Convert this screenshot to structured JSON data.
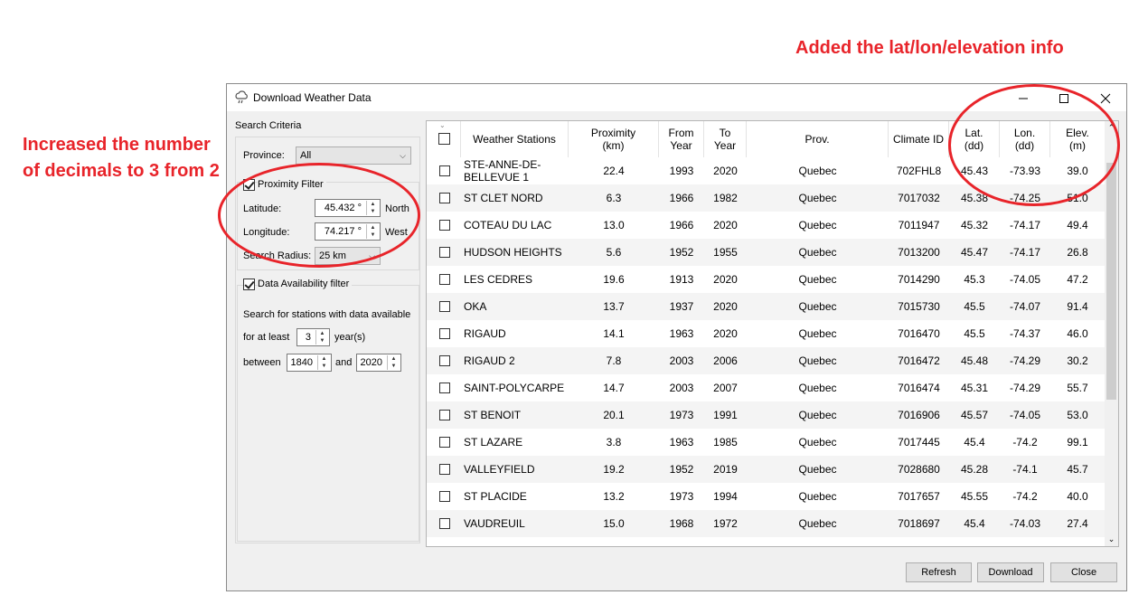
{
  "annotations": {
    "left": "Increased the number of decimals to 3 from 2",
    "top": "Added the lat/lon/elevation info"
  },
  "window": {
    "title": "Download Weather Data",
    "icon": "cloud-rain-icon",
    "minimize": "—",
    "maximize": "☐",
    "close": "✕"
  },
  "criteria": {
    "title": "Search Criteria",
    "province_label": "Province:",
    "province_value": "All",
    "proximity_filter_label": "Proximity Filter",
    "proximity_checked": true,
    "latitude_label": "Latitude:",
    "latitude_value": "45.432 °",
    "latitude_dir": "North",
    "longitude_label": "Longitude:",
    "longitude_value": "74.217 °",
    "longitude_dir": "West",
    "radius_label": "Search Radius:",
    "radius_value": "25 km",
    "availability_label": "Data Availability filter",
    "availability_checked": true,
    "availability_text": "Search for stations with data available",
    "at_least_label": "for at least",
    "at_least_value": "3",
    "years_label": "year(s)",
    "between_label": "between",
    "between_from": "1840",
    "and_label": "and",
    "between_to": "2020"
  },
  "table": {
    "headers": {
      "name": "Weather Stations",
      "proximity": "Proximity\n(km)",
      "from": "From\nYear",
      "to": "To\nYear",
      "prov": "Prov.",
      "climate_id": "Climate ID",
      "lat": "Lat.\n(dd)",
      "lon": "Lon.\n(dd)",
      "elev": "Elev.\n(m)"
    },
    "rows": [
      {
        "name": "STE-ANNE-DE-BELLEVUE 1",
        "proximity": "22.4",
        "from": "1993",
        "to": "2020",
        "prov": "Quebec",
        "climate_id": "702FHL8",
        "lat": "45.43",
        "lon": "-73.93",
        "elev": "39.0"
      },
      {
        "name": "ST CLET NORD",
        "proximity": "6.3",
        "from": "1966",
        "to": "1982",
        "prov": "Quebec",
        "climate_id": "7017032",
        "lat": "45.38",
        "lon": "-74.25",
        "elev": "51.0"
      },
      {
        "name": "COTEAU DU LAC",
        "proximity": "13.0",
        "from": "1966",
        "to": "2020",
        "prov": "Quebec",
        "climate_id": "7011947",
        "lat": "45.32",
        "lon": "-74.17",
        "elev": "49.4"
      },
      {
        "name": "HUDSON HEIGHTS",
        "proximity": "5.6",
        "from": "1952",
        "to": "1955",
        "prov": "Quebec",
        "climate_id": "7013200",
        "lat": "45.47",
        "lon": "-74.17",
        "elev": "26.8"
      },
      {
        "name": "LES CEDRES",
        "proximity": "19.6",
        "from": "1913",
        "to": "2020",
        "prov": "Quebec",
        "climate_id": "7014290",
        "lat": "45.3",
        "lon": "-74.05",
        "elev": "47.2"
      },
      {
        "name": "OKA",
        "proximity": "13.7",
        "from": "1937",
        "to": "2020",
        "prov": "Quebec",
        "climate_id": "7015730",
        "lat": "45.5",
        "lon": "-74.07",
        "elev": "91.4"
      },
      {
        "name": "RIGAUD",
        "proximity": "14.1",
        "from": "1963",
        "to": "2020",
        "prov": "Quebec",
        "climate_id": "7016470",
        "lat": "45.5",
        "lon": "-74.37",
        "elev": "46.0"
      },
      {
        "name": "RIGAUD 2",
        "proximity": "7.8",
        "from": "2003",
        "to": "2006",
        "prov": "Quebec",
        "climate_id": "7016472",
        "lat": "45.48",
        "lon": "-74.29",
        "elev": "30.2"
      },
      {
        "name": "SAINT-POLYCARPE",
        "proximity": "14.7",
        "from": "2003",
        "to": "2007",
        "prov": "Quebec",
        "climate_id": "7016474",
        "lat": "45.31",
        "lon": "-74.29",
        "elev": "55.7"
      },
      {
        "name": "ST BENOIT",
        "proximity": "20.1",
        "from": "1973",
        "to": "1991",
        "prov": "Quebec",
        "climate_id": "7016906",
        "lat": "45.57",
        "lon": "-74.05",
        "elev": "53.0"
      },
      {
        "name": "ST LAZARE",
        "proximity": "3.8",
        "from": "1963",
        "to": "1985",
        "prov": "Quebec",
        "climate_id": "7017445",
        "lat": "45.4",
        "lon": "-74.2",
        "elev": "99.1"
      },
      {
        "name": "VALLEYFIELD",
        "proximity": "19.2",
        "from": "1952",
        "to": "2019",
        "prov": "Quebec",
        "climate_id": "7028680",
        "lat": "45.28",
        "lon": "-74.1",
        "elev": "45.7"
      },
      {
        "name": "ST PLACIDE",
        "proximity": "13.2",
        "from": "1973",
        "to": "1994",
        "prov": "Quebec",
        "climate_id": "7017657",
        "lat": "45.55",
        "lon": "-74.2",
        "elev": "40.0"
      },
      {
        "name": "VAUDREUIL",
        "proximity": "15.0",
        "from": "1968",
        "to": "1972",
        "prov": "Quebec",
        "climate_id": "7018697",
        "lat": "45.4",
        "lon": "-74.03",
        "elev": "27.4"
      }
    ]
  },
  "buttons": {
    "refresh": "Refresh",
    "download": "Download",
    "close": "Close"
  }
}
